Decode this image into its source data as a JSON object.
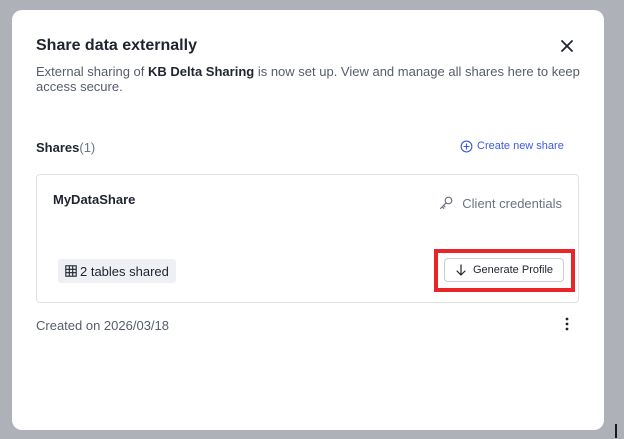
{
  "dialog": {
    "title": "Share data externally",
    "description_before": "External sharing of ",
    "description_bold": "KB Delta Sharing",
    "description_after": " is now set up. View and manage all shares here to keep access secure."
  },
  "shares": {
    "label": "Shares",
    "count": "(1)",
    "create_label": "Create new share"
  },
  "share": {
    "name": "MyDataShare",
    "credentials_label": "Client credentials",
    "tables_badge": "2 tables shared",
    "generate_label": "Generate Profile",
    "created": "Created on 2026/03/18"
  },
  "icons": {
    "close": "close-icon",
    "create": "plus-circle-icon",
    "credentials": "key-icon",
    "tables": "table-icon",
    "generate": "arrow-down-icon",
    "more": "more-vertical-icon"
  },
  "colors": {
    "accent": "#3b5bdb",
    "highlight": "#e8262a",
    "overlay": "#aeb2b8"
  }
}
